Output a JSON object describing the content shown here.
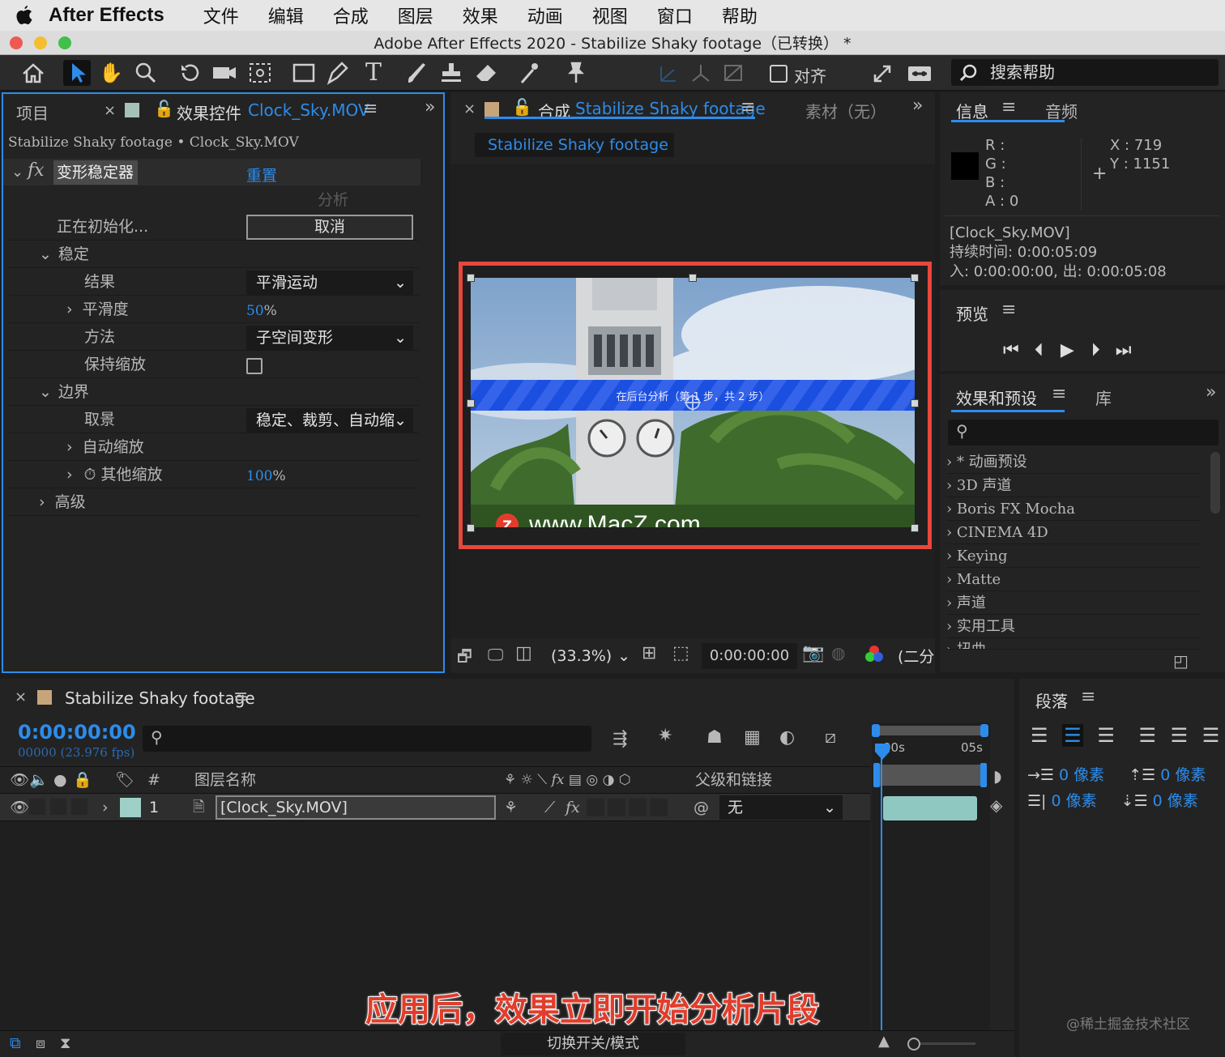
{
  "menubar": {
    "app": "After Effects",
    "items": [
      "文件",
      "编辑",
      "合成",
      "图层",
      "效果",
      "动画",
      "视图",
      "窗口",
      "帮助"
    ]
  },
  "window": {
    "title": "Adobe After Effects 2020 - Stabilize Shaky footage（已转换） *"
  },
  "toolbar": {
    "align_label": "对齐",
    "search_placeholder": "搜索帮助"
  },
  "project_panel": {
    "tab_project": "项目",
    "tab_effects": "效果控件",
    "tab_effects_file": "Clock_Sky.MOV",
    "breadcrumb": "Stabilize Shaky footage • Clock_Sky.MOV"
  },
  "effect": {
    "name": "变形稳定器",
    "reset": "重置",
    "analyze": "分析",
    "status": "正在初始化...",
    "cancel": "取消",
    "stabilize": "稳定",
    "result_label": "结果",
    "result_value": "平滑运动",
    "smoothness_label": "平滑度",
    "smoothness_value": "50",
    "percent": "%",
    "method_label": "方法",
    "method_value": "子空间变形",
    "preserve_scale": "保持缩放",
    "borders": "边界",
    "framing_label": "取景",
    "framing_value": "稳定、裁剪、自动缩",
    "auto_scale": "自动缩放",
    "other_scale": "其他缩放",
    "other_scale_value": "100",
    "advanced": "高级"
  },
  "comp_panel": {
    "tab_comp": "合成",
    "comp_name": "Stabilize Shaky footage",
    "footage_tab": "素材（无）",
    "comp_button": "Stabilize Shaky footage",
    "analysis_banner": "在后台分析（第 1 步，共 2 步）",
    "watermark": "www.MacZ.com",
    "zoom": "(33.3%)",
    "timecode": "0:00:00:00",
    "resolution": "(二分"
  },
  "info_panel": {
    "tab_info": "信息",
    "tab_audio": "音频",
    "r": "R :",
    "g": "G :",
    "b": "B :",
    "a": "A :  0",
    "x": "X : 719",
    "y": "Y : 1151",
    "file": "[Clock_Sky.MOV]",
    "duration": "持续时间: 0:00:05:09",
    "inout": "入: 0:00:00:00,  出: 0:00:05:08"
  },
  "preview_panel": {
    "title": "预览"
  },
  "effects_presets": {
    "title": "效果和预设",
    "library": "库",
    "items": [
      "* 动画预设",
      "3D 声道",
      "Boris FX Mocha",
      "CINEMA 4D",
      "Keying",
      "Matte",
      "声道",
      "实用工具",
      "扭曲"
    ]
  },
  "timeline": {
    "comp_name": "Stabilize Shaky footage",
    "timecode": "0:00:00:00",
    "fps": "00000 (23.976 fps)",
    "col_num": "#",
    "col_layer_name": "图层名称",
    "col_parent": "父级和链接",
    "ruler_0": "00s",
    "ruler_5": "05s",
    "layer": {
      "index": "1",
      "name": "[Clock_Sky.MOV]",
      "parent": "无"
    },
    "toggle_label": "切换开关/模式"
  },
  "paragraph_panel": {
    "title": "段落",
    "indent_values": [
      "0 像素",
      "0 像素",
      "0 像素",
      "0 像素"
    ]
  },
  "caption": "应用后，效果立即开始分析片段",
  "credit": "@稀土掘金技术社区",
  "colors": {
    "accent_blue": "#2d8ceb",
    "highlight_red": "#e8473c",
    "banner_blue": "#1a4fe0",
    "caption_red": "#e23d2c",
    "layer_teal": "#8fc8c0"
  }
}
